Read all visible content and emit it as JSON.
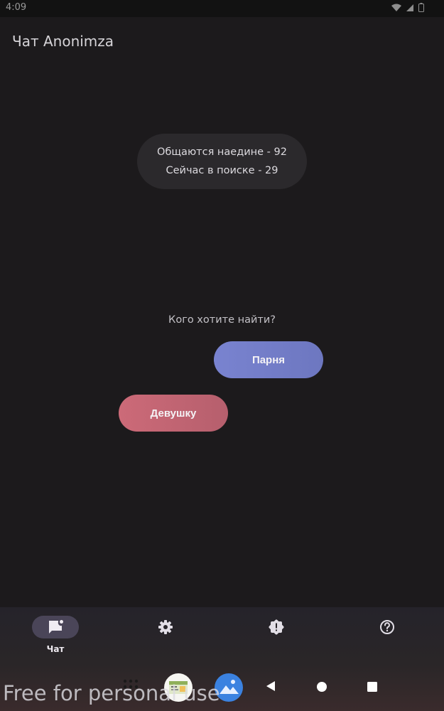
{
  "status_bar": {
    "time": "4:09",
    "icons": [
      "wifi-icon",
      "signal-icon",
      "battery-icon"
    ]
  },
  "app": {
    "title": "Чат Anonimza"
  },
  "stats": {
    "line1": "Общаются наедине - 92",
    "line2": "Сейчас в поиске - 29"
  },
  "search": {
    "question": "Кого хотите найти?",
    "male_label": "Парня",
    "female_label": "Девушку"
  },
  "bottom_nav": {
    "items": [
      {
        "icon": "chat-icon",
        "label": "Чат",
        "active": true
      },
      {
        "icon": "settings-icon",
        "label": "",
        "active": false
      },
      {
        "icon": "alert-icon",
        "label": "",
        "active": false
      },
      {
        "icon": "help-icon",
        "label": "",
        "active": false
      }
    ]
  },
  "system_nav": {
    "items": [
      "apps-grid-icon",
      "app-thumbnail-icon",
      "gallery-icon",
      "back-icon",
      "home-icon",
      "recents-icon"
    ]
  },
  "watermark": {
    "text": "Free for personal use"
  },
  "colors": {
    "background": "#1c1a1c",
    "male_button": "#7480c9",
    "female_button": "#c26674",
    "nav_active_indicator": "#4a4558"
  }
}
